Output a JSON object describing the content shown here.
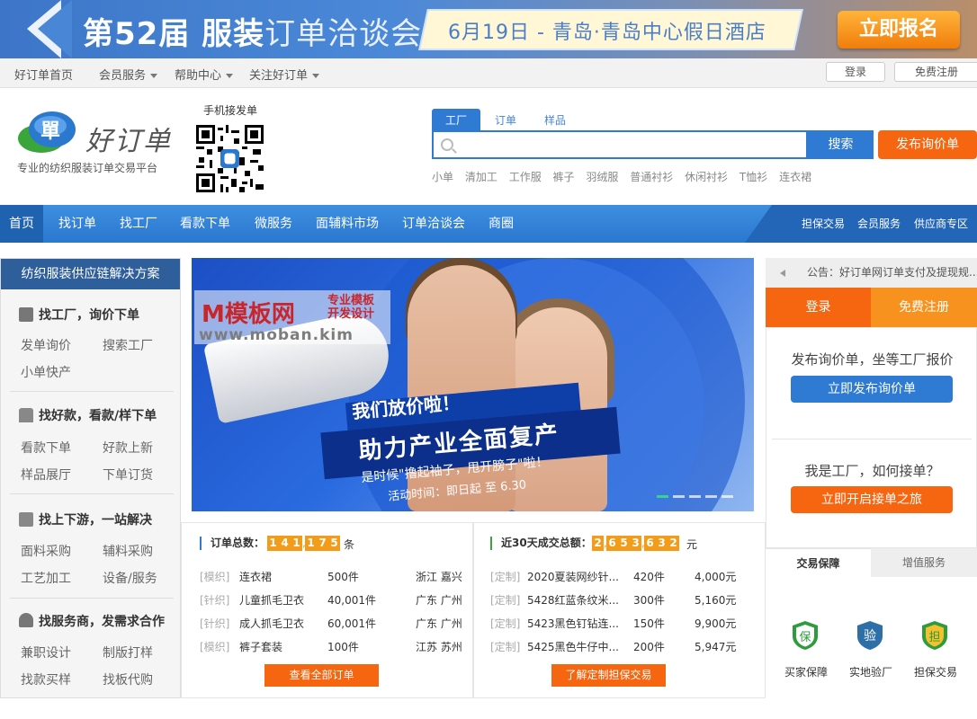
{
  "banner": {
    "title_main": "第52届 服装",
    "title_sub": "订单洽谈会",
    "date_text": "6月19日 - 青岛·青岛中心假日酒店",
    "register_label": "立即报名"
  },
  "topnav": {
    "items": [
      "好订单首页",
      "会员服务",
      "帮助中心",
      "关注好订单"
    ],
    "login_label": "登录",
    "register_label": "免费注册"
  },
  "header": {
    "logo_text": "好订单",
    "tagline": "专业的纺织服装订单交易平台",
    "qr_label": "手机接发单"
  },
  "search": {
    "tabs": [
      "工厂",
      "订单",
      "样品"
    ],
    "active_tab": "工厂",
    "placeholder": "",
    "button_label": "搜索",
    "post_label": "发布询价单",
    "hot_words": [
      "小单",
      "清加工",
      "工作服",
      "裤子",
      "羽绒服",
      "普通衬衫",
      "休闲衬衫",
      "T恤衫",
      "连衣裙"
    ]
  },
  "mainnav": {
    "items": [
      "首页",
      "找订单",
      "找工厂",
      "看款下单",
      "微服务",
      "面辅料市场",
      "订单洽谈会",
      "商圈"
    ],
    "right_items": [
      "担保交易",
      "会员服务",
      "供应商专区"
    ]
  },
  "sidebar": {
    "title": "纺织服装供应链解决方案",
    "groups": [
      {
        "title": "找工厂，询价下单",
        "links": [
          "发单询价",
          "搜索工厂",
          "小单快产"
        ]
      },
      {
        "title": "找好款，看款/样下单",
        "links": [
          "看款下单",
          "好款上新",
          "样品展厅",
          "下单订货"
        ]
      },
      {
        "title": "找上下游，一站解决",
        "links": [
          "面料采购",
          "辅料采购",
          "工艺加工",
          "设备/服务"
        ]
      },
      {
        "title": "找服务商，发需求合作",
        "links": [
          "兼职设计",
          "制版打样",
          "找款买样",
          "找板代购"
        ]
      }
    ]
  },
  "carousel": {
    "caption1": "我们放价啦！",
    "caption2": "助力产业全面复产",
    "caption3": "是时候\"撸起袖子，甩开膀子\"啦！",
    "caption4": "活动时间：即日起 至 6.30",
    "slide_count": 5,
    "active_slide": 1
  },
  "watermark": {
    "brand": "M模板网",
    "tag1": "专业模板",
    "tag2": "开发设计",
    "url": "www.moban.kim"
  },
  "orders": {
    "label": "订单总数：",
    "digits": [
      "1",
      "4",
      "1",
      ",",
      "1",
      "7",
      "5"
    ],
    "unit": "条",
    "rows": [
      {
        "tag": "[模织]",
        "name": "连衣裙",
        "qty": "500件",
        "loc": "浙江 嘉兴"
      },
      {
        "tag": "[针织]",
        "name": "儿童抓毛卫衣",
        "qty": "40,001件",
        "loc": "广东 广州"
      },
      {
        "tag": "[针织]",
        "name": "成人抓毛卫衣",
        "qty": "60,001件",
        "loc": "广东 广州"
      },
      {
        "tag": "[模织]",
        "name": "裤子套装",
        "qty": "100件",
        "loc": "江苏 苏州"
      }
    ],
    "button_label": "查看全部订单"
  },
  "deals": {
    "label": "近30天成交总额：",
    "digits": [
      "2",
      ",",
      "6",
      "5",
      "3",
      ",",
      "6",
      "3",
      "2"
    ],
    "unit": "元",
    "rows": [
      {
        "tag": "[定制]",
        "name": "2020夏装网纱针...",
        "qty": "420件",
        "amount": "4,000元"
      },
      {
        "tag": "[定制]",
        "name": "5428红蓝条纹米...",
        "qty": "300件",
        "amount": "5,160元"
      },
      {
        "tag": "[定制]",
        "name": "5423黑色钉钻连...",
        "qty": "150件",
        "amount": "9,900元"
      },
      {
        "tag": "[定制]",
        "name": "5425黑色牛仔中...",
        "qty": "200件",
        "amount": "5,947元"
      }
    ],
    "button_label": "了解定制担保交易"
  },
  "rightcol": {
    "notice": "公告：好订单网订单支付及提现规...",
    "login_label": "登录",
    "register_label": "免费注册",
    "buyer_text": "发布询价单，坐等工厂报价",
    "buyer_button": "立即发布询价单",
    "factory_text": "我是工厂，如何接单？",
    "factory_button": "立即开启接单之旅",
    "tabs": [
      "交易保障",
      "增值服务"
    ],
    "guarantees": [
      {
        "icon": "保",
        "label": "买家保障"
      },
      {
        "icon": "验",
        "label": "实地验厂"
      },
      {
        "icon": "担",
        "label": "担保交易"
      }
    ]
  },
  "colors": {
    "primary_blue": "#2f7bd3",
    "orange": "#f6650f",
    "nav_dark": "#1f63b0",
    "digit_orange": "#f39c1a"
  }
}
